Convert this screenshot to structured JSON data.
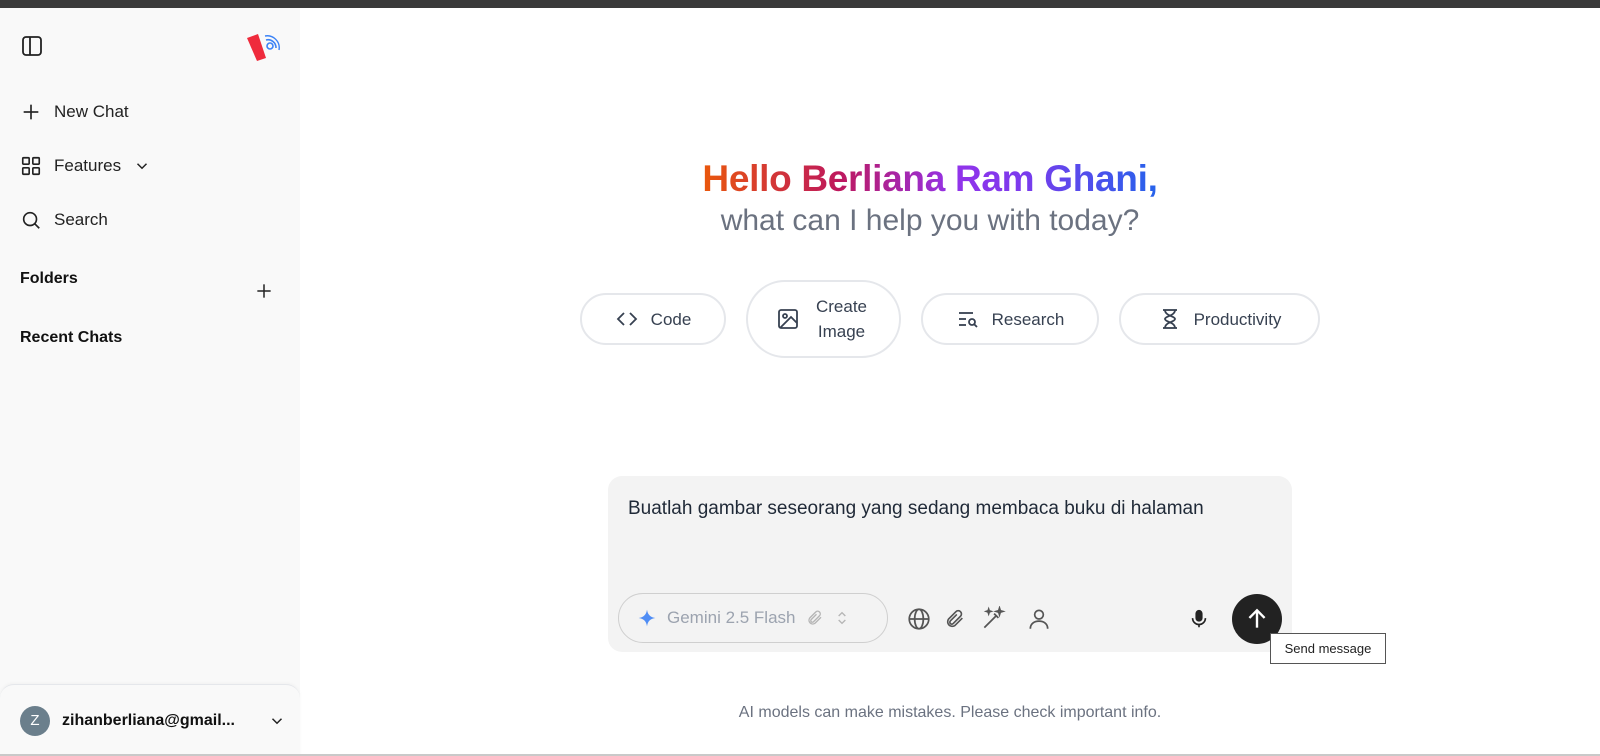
{
  "sidebar": {
    "nav": {
      "new_chat": "New Chat",
      "features": "Features",
      "search": "Search"
    },
    "folders_title": "Folders",
    "recent_title": "Recent Chats",
    "user": {
      "initial": "Z",
      "email": "zihanberliana@gmail..."
    }
  },
  "main": {
    "greeting": "Hello Berliana Ram Ghani,",
    "subtitle": "what can I help you with today?",
    "chips": [
      {
        "label": "Code",
        "icon": "code-icon"
      },
      {
        "label": "Create Image",
        "icon": "image-icon"
      },
      {
        "label": "Research",
        "icon": "research-icon"
      },
      {
        "label": "Productivity",
        "icon": "hourglass-icon"
      }
    ],
    "composer": {
      "value": "Buatlah gambar seseorang yang sedang membaca buku di halaman",
      "model": "Gemini 2.5 Flash"
    },
    "tooltip": "Send message",
    "disclaimer": "AI models can make mistakes. Please check important info."
  },
  "colors": {
    "accent_dark": "#222222",
    "greeting_gradient": [
      "#ea580c",
      "#be185d",
      "#9333ea",
      "#2563eb"
    ]
  }
}
